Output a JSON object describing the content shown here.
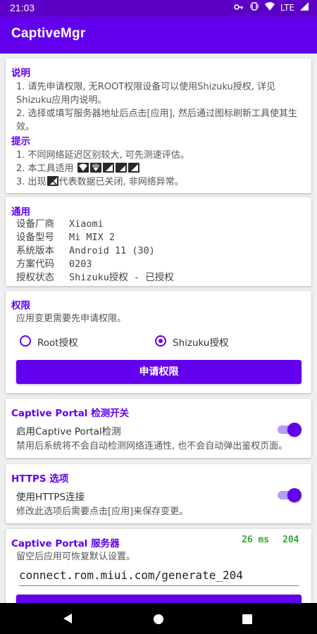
{
  "statusbar": {
    "time": "21:03",
    "network": "LTE"
  },
  "app": {
    "title": "CaptiveMgr"
  },
  "notes": {
    "title1": "说明",
    "lines1": [
      "1. 请先申请权限, 无ROOT权限设备可以使用Shizuku授权, 详见",
      "Shizuku应用内说明。",
      "2. 选择或填写服务器地址后点击[应用], 然后通过图标刷新工具使其生",
      "效。"
    ],
    "title2": "提示",
    "tip1": "1. 不同网络延迟区别较大, 可先测速评估。",
    "tip2_prefix": "2. 本工具适用",
    "tip3_prefix": "3. 出现",
    "tip3_suffix": "代表数据已关闭, 非网络异常。"
  },
  "general": {
    "title": "通用",
    "rows": [
      {
        "key": "设备厂商",
        "value": "Xiaomi"
      },
      {
        "key": "设备型号",
        "value": "Mi MIX 2"
      },
      {
        "key": "系统版本",
        "value": "Android 11 (30)"
      },
      {
        "key": "方案代码",
        "value": "0203"
      },
      {
        "key": "授权状态",
        "value": "Shizuku授权 - 已授权"
      }
    ]
  },
  "permission": {
    "title": "权限",
    "desc": "应用变更需要先申请权限。",
    "option_root": "Root授权",
    "option_shizuku": "Shizuku授权",
    "selected": "Shizuku授权",
    "button": "申请权限"
  },
  "captive_detect": {
    "title": "Captive Portal 检测开关",
    "label": "启用Captive Portal检测",
    "desc": "禁用后系统将不会自动检测网络连通性, 也不会自动弹出鉴权页面。",
    "enabled": true
  },
  "https": {
    "title": "HTTPS 选项",
    "label": "使用HTTPS连接",
    "desc": "修改此选项后需要点击[应用]来保存变更。",
    "enabled": true
  },
  "server": {
    "title": "Captive Portal 服务器",
    "latency": "26 ms",
    "code": "204",
    "desc": "留空后应用可恢复默认设置。",
    "value": "connect.rom.miui.com/generate_204"
  },
  "colors": {
    "primary": "#6200ee",
    "status": "#5c00c8",
    "ok": "#2eaa3a"
  },
  "icons": [
    "vpn-key-icon",
    "vibrate-icon",
    "wifi-icon",
    "lte-icon",
    "battery-icon",
    "back-icon",
    "home-icon",
    "recents-icon"
  ]
}
